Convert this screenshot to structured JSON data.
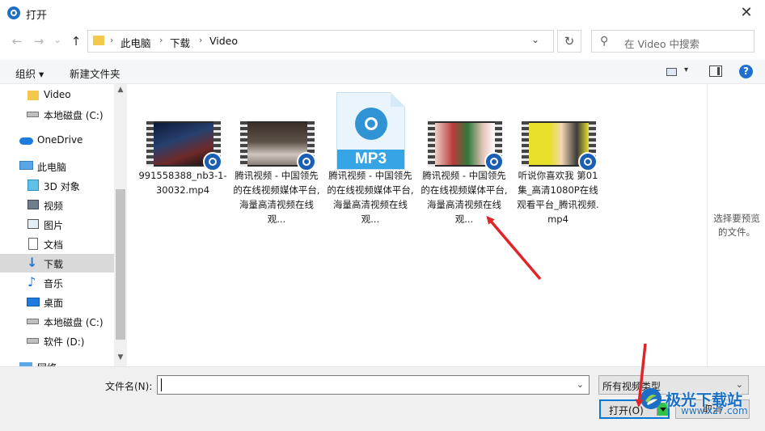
{
  "window": {
    "title": "打开",
    "close_label": "✕"
  },
  "nav": {
    "back": "←",
    "forward": "→",
    "recent": "⌄",
    "up": "↑",
    "breadcrumb": [
      "此电脑",
      "下载",
      "Video"
    ],
    "separator": "›",
    "dropdown": "⌄",
    "refresh": "↻"
  },
  "search": {
    "placeholder": "在 Video 中搜索",
    "icon": "search-icon"
  },
  "toolbar": {
    "organize_label": "组织 ▾",
    "newfolder_label": "新建文件夹",
    "view_chevron": "▾",
    "help_label": "?"
  },
  "sidebar": {
    "items": [
      {
        "label": "Video",
        "icon": "folder-icon"
      },
      {
        "label": "本地磁盘 (C:)",
        "icon": "drive-icon"
      },
      {
        "label": "OneDrive",
        "icon": "cloud-icon"
      },
      {
        "label": "此电脑",
        "icon": "computer-icon"
      },
      {
        "label": "3D 对象",
        "icon": "cube-icon"
      },
      {
        "label": "视频",
        "icon": "video-icon"
      },
      {
        "label": "图片",
        "icon": "picture-icon"
      },
      {
        "label": "文档",
        "icon": "document-icon"
      },
      {
        "label": "下载",
        "icon": "download-icon",
        "selected": true
      },
      {
        "label": "音乐",
        "icon": "music-icon"
      },
      {
        "label": "桌面",
        "icon": "desktop-icon"
      },
      {
        "label": "本地磁盘 (C:)",
        "icon": "drive-icon"
      },
      {
        "label": "软件 (D:)",
        "icon": "drive-icon"
      },
      {
        "label": "网络",
        "icon": "network-icon"
      }
    ],
    "scroll_up": "▲",
    "scroll_down": "▼"
  },
  "files": [
    {
      "name": "991558388_nb3-1-30032.mp4",
      "type": "video"
    },
    {
      "name": "腾讯视频 - 中国领先的在线视频媒体平台,海量高清视频在线观...",
      "type": "video"
    },
    {
      "name": "腾讯视频 - 中国领先的在线视频媒体平台,海量高清视频在线观...",
      "type": "mp3",
      "thumb_label": "MP3"
    },
    {
      "name": "腾讯视频 - 中国领先的在线视频媒体平台,海量高清视频在线观...",
      "type": "video"
    },
    {
      "name": "听说你喜欢我 第01集_高清1080P在线观看平台_腾讯视频.mp4",
      "type": "video"
    }
  ],
  "preview": {
    "text": "选择要预览的文件。"
  },
  "bottom": {
    "filename_label": "文件名(N):",
    "filename_value": "",
    "filename_dropdown": "⌄",
    "filetype_value": "所有视频类型",
    "filetype_dropdown": "⌄",
    "open_label": "打开(O)",
    "cancel_label": "取消"
  },
  "watermark": {
    "text": "极光下载站",
    "url": "www.xz7.com"
  },
  "colors": {
    "accent": "#0078d7",
    "selection": "#d9d9d9",
    "badge": "#1b5fb4",
    "arrow": "#e0242a",
    "split_button": "#31c24a"
  }
}
